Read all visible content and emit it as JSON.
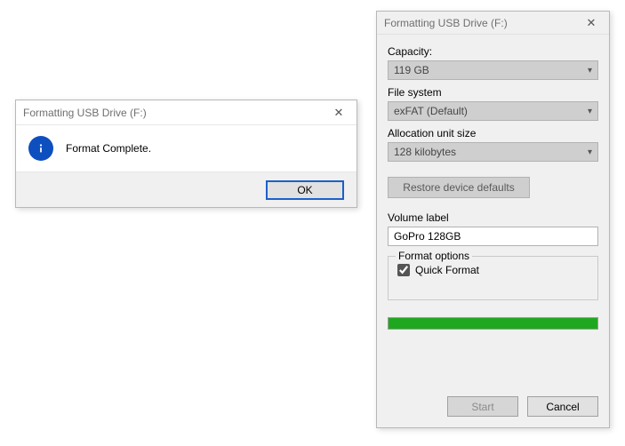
{
  "msg_dialog": {
    "title": "Formatting USB Drive (F:)",
    "icon": "info-icon",
    "message": "Format Complete.",
    "ok_label": "OK"
  },
  "fmt_dialog": {
    "title": "Formatting USB Drive (F:)",
    "capacity_label": "Capacity:",
    "capacity_value": "119 GB",
    "fs_label": "File system",
    "fs_value": "exFAT (Default)",
    "alloc_label": "Allocation unit size",
    "alloc_value": "128 kilobytes",
    "restore_label": "Restore device defaults",
    "volume_label_label": "Volume label",
    "volume_label_value": "GoPro 128GB",
    "options_legend": "Format options",
    "quick_format_label": "Quick Format",
    "quick_format_checked": true,
    "progress_percent": 100,
    "start_label": "Start",
    "close_label": "Cancel"
  }
}
